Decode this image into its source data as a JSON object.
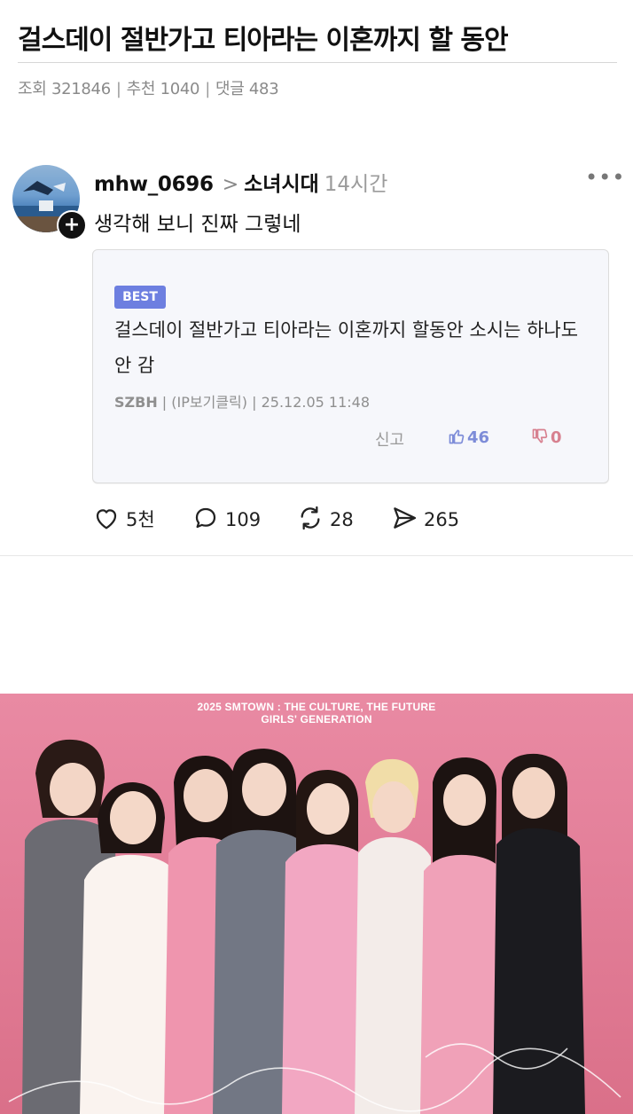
{
  "article": {
    "title": "걸스데이 절반가고 티아라는 이혼까지 할 동안",
    "views": "조회 321846",
    "recommends": "추천 1040",
    "comments_count": "댓글 483",
    "separator": "|"
  },
  "post": {
    "username": "mhw_0696",
    "channel": "소녀시대",
    "time": "14시간",
    "text": "생각해 보니 진짜 그렇네",
    "more_icon": "more-horizontal-icon",
    "follow_symbol": "+"
  },
  "quote": {
    "badge": "BEST",
    "text": "걸스데이 절반가고 티아라는 이혼까지 할동안 소시는 하나도 안 감",
    "author": "SZBH",
    "ip": "(IP보기클릭)",
    "date": "25.12.05 11:48",
    "report": "신고",
    "upvotes": "46",
    "downvotes": "0"
  },
  "actions": {
    "likes": "5천",
    "comments": "109",
    "reposts": "28",
    "shares": "265"
  },
  "poster": {
    "line1": "2025 SMTOWN : THE CULTURE, THE FUTURE",
    "line2": "GIRLS' GENERATION"
  },
  "colors": {
    "badge": "#6d7fe0",
    "upvote": "#7d8cd8",
    "downvote": "#d7808f",
    "poster_bg": "#e27d97"
  }
}
